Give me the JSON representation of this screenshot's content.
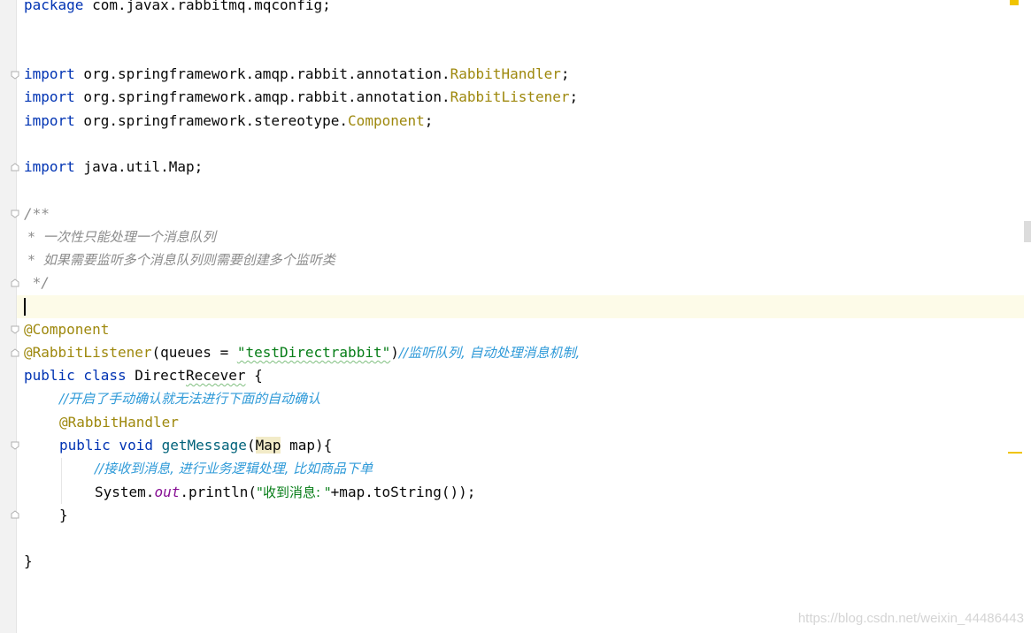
{
  "editor": {
    "lines": {
      "package_kw": "package",
      "package_name": " com.javax.rabbitmq.mqconfig;",
      "import_kw": "import",
      "import1_pkg": " org.springframework.amqp.rabbit.annotation.",
      "import1_cls": "RabbitHandler",
      "import2_pkg": " org.springframework.amqp.rabbit.annotation.",
      "import2_cls": "RabbitListener",
      "import3_pkg": " org.springframework.stereotype.",
      "import3_cls": "Component",
      "import4_pkg": " java.util.",
      "import4_cls": "Map",
      "semicolon": ";",
      "doc_open": "/**",
      "doc_line1": " *  一次性只能处理一个消息队列",
      "doc_line2": " *  如果需要监听多个消息队列则需要创建多个监听类",
      "doc_close": " */",
      "ann_component": "@Component",
      "ann_listener": "@RabbitListener",
      "listener_args_open": "(queues = ",
      "listener_queue": "\"testDirectrabbit\"",
      "listener_args_close": ")",
      "listener_comment": "//监听队列, 自动处理消息机制,",
      "class_public": "public",
      "class_kw": " class",
      "class_name_a": " Direct",
      "class_name_b": "Recever",
      "class_brace": " {",
      "comment_ack": "//开启了手动确认就无法进行下面的自动确认",
      "ann_handler": "@RabbitHandler",
      "method_public": "public",
      "method_void": " void",
      "method_name": " getMessage",
      "method_paren": "(",
      "method_param_type": "Map",
      "method_param": " map){",
      "comment_biz": "//接收到消息, 进行业务逻辑处理, 比如商品下单",
      "sys": "System.",
      "sys_out": "out",
      "println_open": ".println(",
      "println_str": "\"收到消息: \"",
      "println_rest": "+map.toString());",
      "close_method": "}",
      "close_class": "}"
    }
  },
  "watermark": "https://blog.csdn.net/weixin_44486443",
  "colors": {
    "keyword": "#0033b3",
    "annotation": "#9e880d",
    "string": "#067d17",
    "comment": "#8c8c8c",
    "line_comment": "#2f9ad8"
  }
}
